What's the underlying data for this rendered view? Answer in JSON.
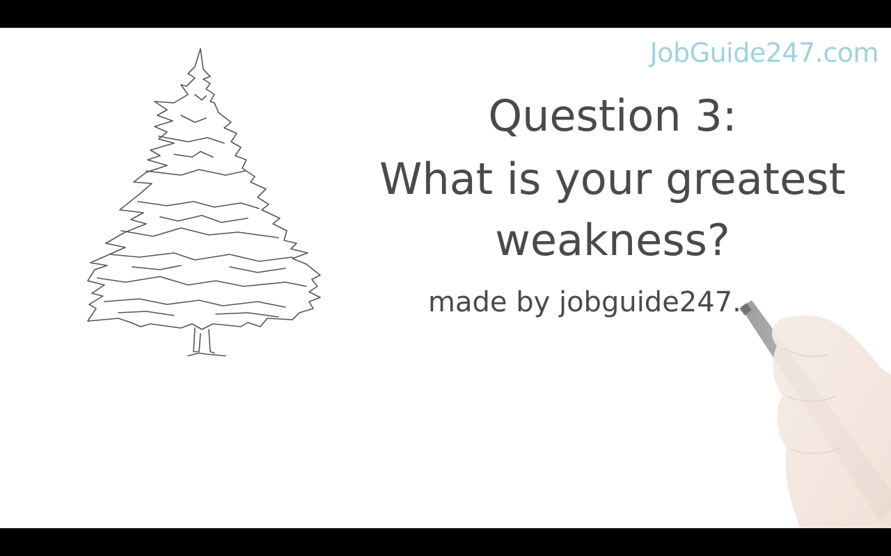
{
  "watermark": "JobGuide247.com",
  "question": {
    "title": "Question 3:",
    "line1": "What is your greatest",
    "line2": "weakness?"
  },
  "credit": "made by jobguide247.",
  "colors": {
    "text": "#4a4a4a",
    "watermark": "#9fd3dc",
    "background": "#ffffff",
    "letterbox": "#000000"
  },
  "illustrations": [
    "pine-tree-sketch",
    "hand-holding-marker"
  ]
}
